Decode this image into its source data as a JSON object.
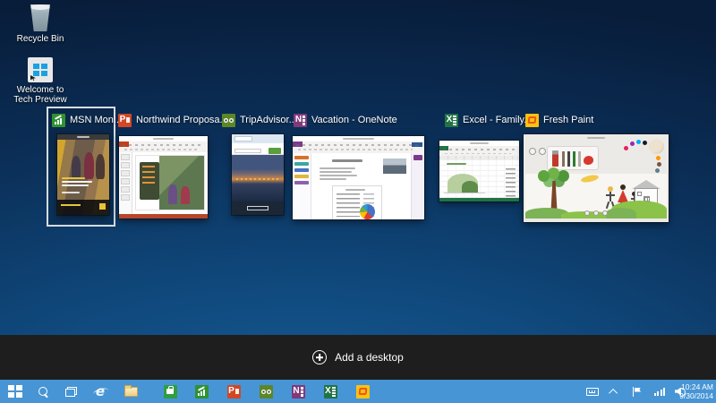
{
  "desktop": {
    "icons": [
      {
        "label": "Recycle Bin"
      },
      {
        "label": "Welcome to Tech Preview"
      }
    ]
  },
  "task_view": {
    "windows": [
      {
        "title": "MSN Mon...",
        "app": "msn-money",
        "selected": true
      },
      {
        "title": "Northwind Proposa...",
        "app": "powerpoint",
        "selected": false
      },
      {
        "title": "TripAdvisor...",
        "app": "tripadvisor",
        "selected": false
      },
      {
        "title": "Vacation - OneNote",
        "app": "onenote",
        "selected": false
      },
      {
        "title": "Excel - Family...",
        "app": "excel",
        "selected": false
      },
      {
        "title": "Fresh Paint",
        "app": "fresh-paint",
        "selected": false
      }
    ],
    "add_desktop_label": "Add a desktop"
  },
  "taskbar": {
    "items": [
      "start",
      "search",
      "task-view",
      "internet-explorer",
      "file-explorer",
      "store",
      "msn-money",
      "powerpoint",
      "tripadvisor",
      "onenote",
      "excel",
      "fresh-paint"
    ],
    "tray_icons": [
      "touch-keyboard",
      "show-hidden-icons",
      "action-center-flag",
      "network-signal",
      "volume"
    ],
    "clock": {
      "time": "10:24 AM",
      "date": "9/30/2014"
    }
  },
  "colors": {
    "taskbar": "#4795d5",
    "selection_border": "#d6dde3",
    "add_desktop_bar": "#1e1e1e",
    "app_tiles": {
      "store": "#2f9e41",
      "msn_money": "#2f9232",
      "powerpoint": "#d24726",
      "tripadvisor": "#5c8727",
      "onenote": "#80397b",
      "excel": "#217346",
      "fresh_paint": "#ffc20e"
    }
  }
}
